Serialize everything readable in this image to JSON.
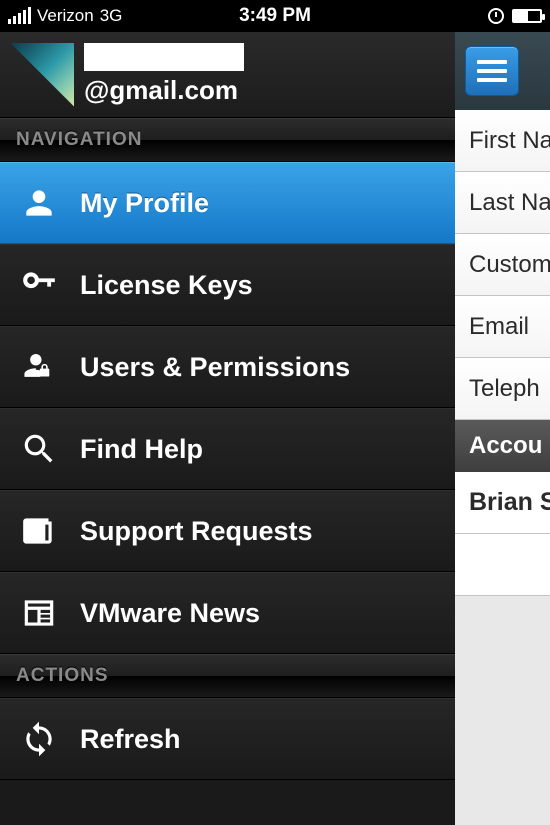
{
  "status": {
    "carrier": "Verizon",
    "network": "3G",
    "time": "3:49 PM"
  },
  "drawer": {
    "email": "@gmail.com",
    "sections": {
      "navigation_label": "NAVIGATION",
      "actions_label": "ACTIONS"
    },
    "nav": [
      {
        "label": "My Profile",
        "icon": "person-icon",
        "active": true
      },
      {
        "label": "License Keys",
        "icon": "key-icon",
        "active": false
      },
      {
        "label": "Users & Permissions",
        "icon": "user-lock-icon",
        "active": false
      },
      {
        "label": "Find Help",
        "icon": "search-icon",
        "active": false
      },
      {
        "label": "Support Requests",
        "icon": "newspaper-icon",
        "active": false
      },
      {
        "label": "VMware News",
        "icon": "news-icon",
        "active": false
      }
    ],
    "actions": [
      {
        "label": "Refresh",
        "icon": "refresh-icon"
      }
    ]
  },
  "main": {
    "rows": [
      "First Na",
      "Last Na",
      "Custom",
      "Email",
      "Teleph"
    ],
    "account_header": "Accou",
    "account_name": "Brian S"
  }
}
